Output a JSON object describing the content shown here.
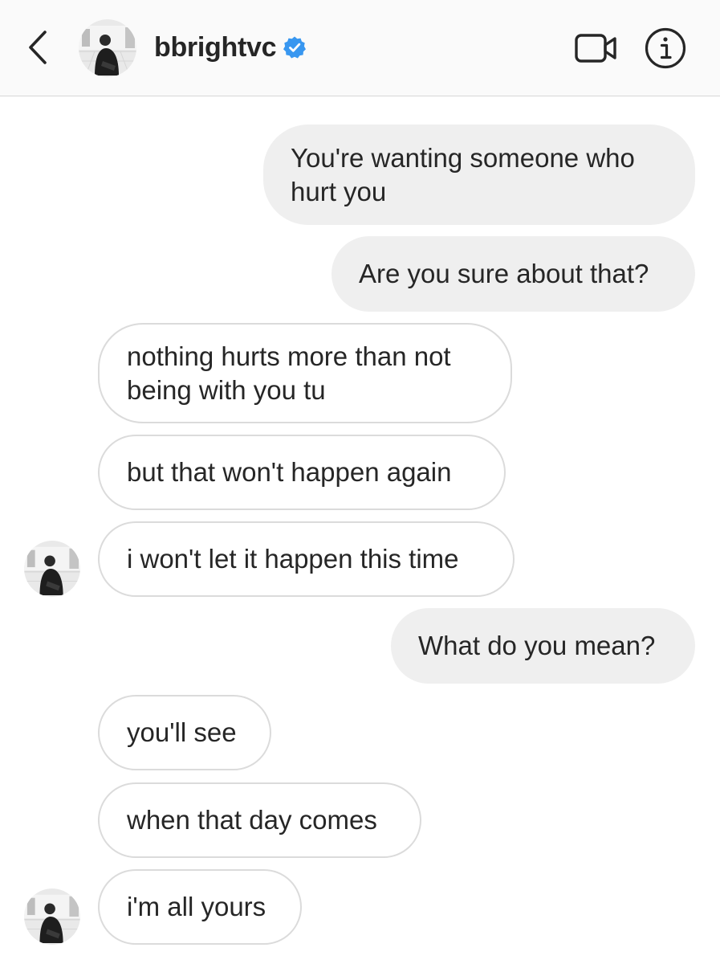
{
  "header": {
    "username": "bbright​vc",
    "verified": true,
    "icons": {
      "back": "chevron-left-icon",
      "verified": "verified-badge-icon",
      "video": "video-camera-icon",
      "info": "info-icon"
    },
    "colors": {
      "verified": "#3897f0",
      "background": "#fafafa"
    }
  },
  "messages": [
    {
      "from": "me",
      "text": "You're wanting someone who\nhurt you"
    },
    {
      "from": "me",
      "text": "Are you sure about that?"
    },
    {
      "from": "them",
      "text": "nothing hurts more than not\nbeing with you tu"
    },
    {
      "from": "them",
      "text": "but that won't happen again"
    },
    {
      "from": "them",
      "text": "i won't let it happen this time"
    },
    {
      "from": "me",
      "text": "What do you mean?"
    },
    {
      "from": "them",
      "text": "you'll see"
    },
    {
      "from": "them",
      "text": "when that day comes"
    },
    {
      "from": "them",
      "text": "i'm all yours"
    }
  ],
  "colors": {
    "sent_bubble": "#efefef",
    "received_border": "#dbdbdb",
    "text": "#262626"
  }
}
